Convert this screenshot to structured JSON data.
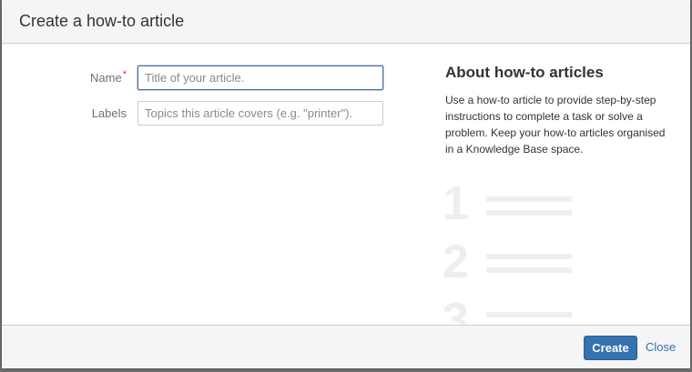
{
  "dialog": {
    "title": "Create a how-to article"
  },
  "form": {
    "name_label": "Name",
    "name_required_marker": "*",
    "name_placeholder": "Title of your article.",
    "name_value": "",
    "labels_label": "Labels",
    "labels_placeholder": "Topics this article covers (e.g. \"printer\").",
    "labels_value": ""
  },
  "about": {
    "title": "About how-to articles",
    "text": "Use a how-to article to provide step-by-step instructions to complete a task or solve a problem. Keep your how-to articles organised in a Knowledge Base space.",
    "steps": [
      "1",
      "2",
      "3"
    ]
  },
  "footer": {
    "create_label": "Create",
    "close_label": "Close"
  },
  "colors": {
    "primary": "#3572b0",
    "required": "#d04437",
    "focus_border": "#4a6ea3"
  }
}
